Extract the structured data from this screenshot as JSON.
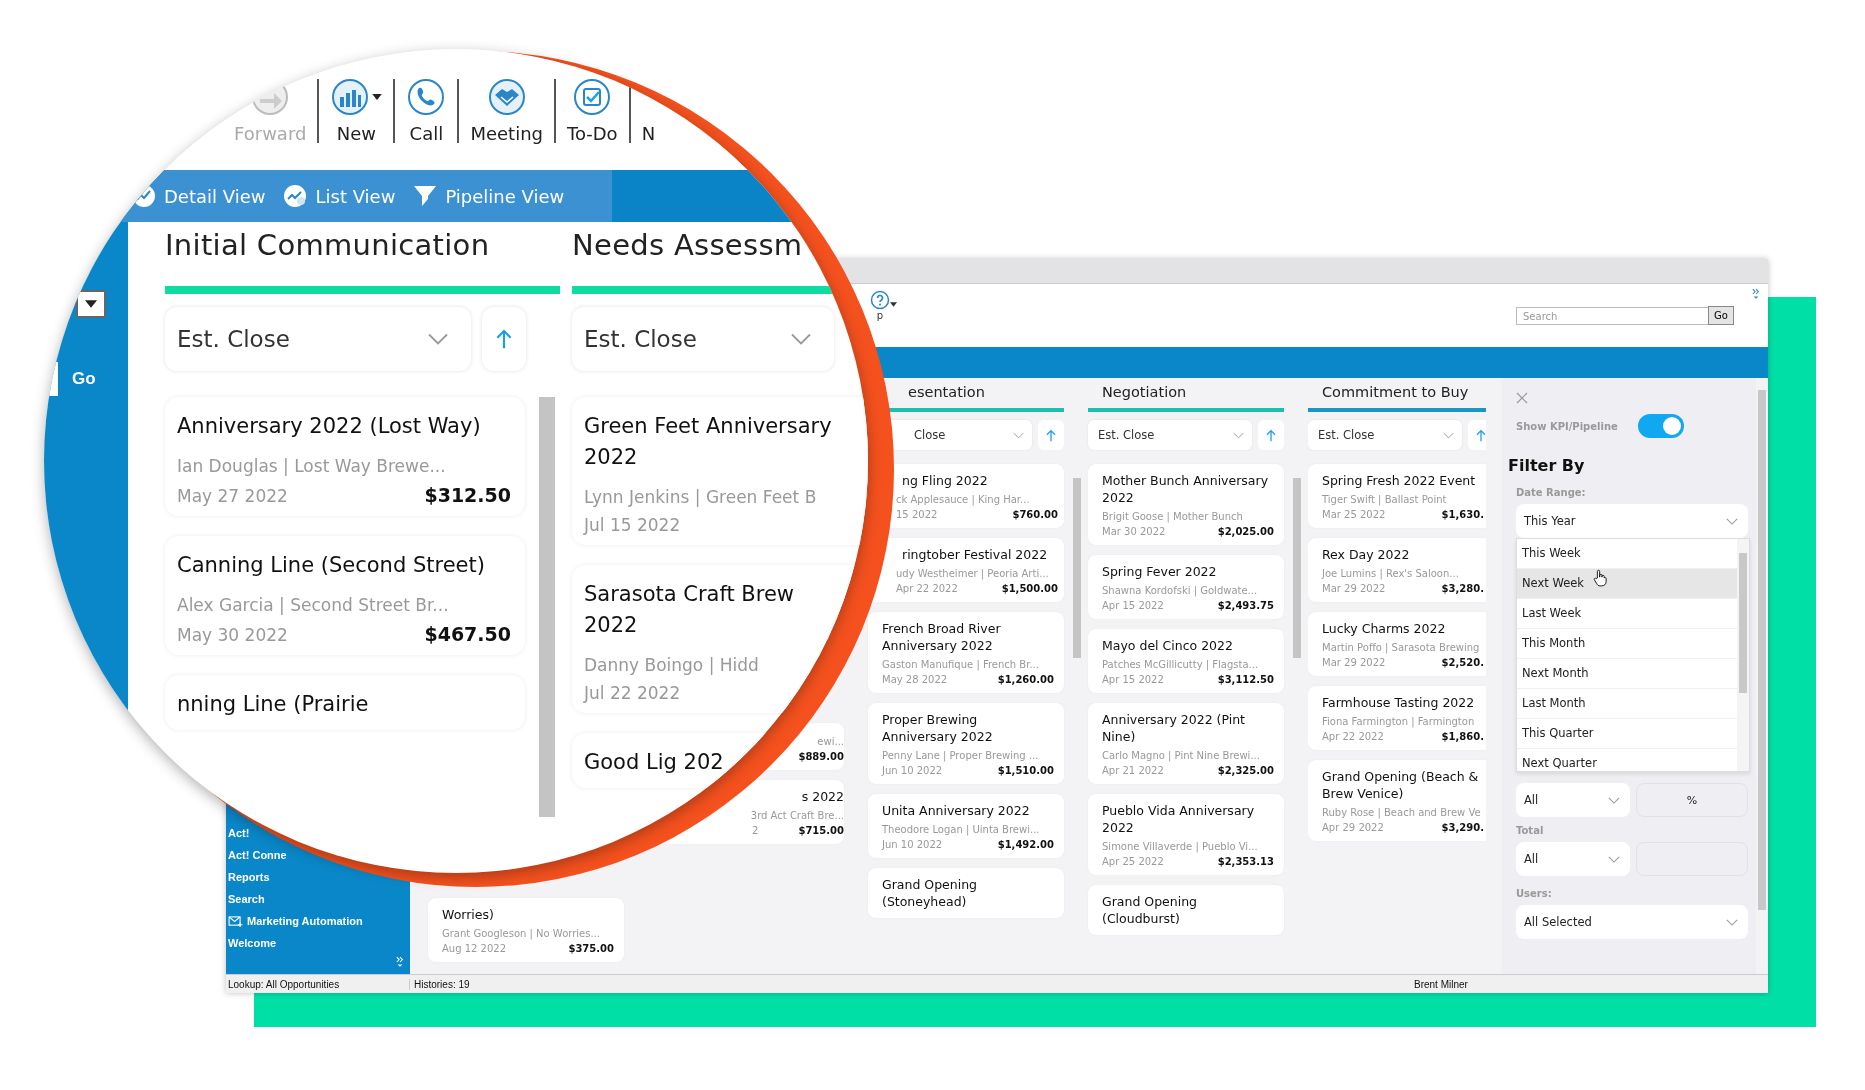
{
  "lens": {
    "toolbar": [
      {
        "kind": "forward",
        "label": "Forward",
        "disabled": true,
        "has_menu": false
      },
      {
        "kind": "new",
        "label": "New",
        "disabled": false,
        "has_menu": true
      },
      {
        "kind": "call",
        "label": "Call",
        "disabled": false,
        "has_menu": false
      },
      {
        "kind": "meeting",
        "label": "Meeting",
        "disabled": false,
        "has_menu": false
      },
      {
        "kind": "todo",
        "label": "To-Do",
        "disabled": false,
        "has_menu": false
      },
      {
        "kind": "cut",
        "label": "N",
        "disabled": false,
        "has_menu": false
      }
    ],
    "tabs": [
      {
        "kind": "detail",
        "label": "Detail View"
      },
      {
        "kind": "list",
        "label": "List View"
      },
      {
        "kind": "pipeline",
        "label": "Pipeline View"
      }
    ],
    "go_button": "Go",
    "columns": [
      {
        "title": "Initial Communication",
        "color": "#10dca2",
        "sort": "Est. Close",
        "cards": [
          {
            "title": "Anniversary 2022 (Lost Way)",
            "contact": "Ian Douglas | Lost Way Brewe...",
            "date": "May 27 2022",
            "amount": "$312.50"
          },
          {
            "title": "Canning Line (Second Street)",
            "contact": "Alex Garcia | Second Street Br...",
            "date": "May 30 2022",
            "amount": "$467.50"
          },
          {
            "title": "nning Line (Prairie"
          }
        ]
      },
      {
        "title": "Needs Assessm",
        "color": "#10dca2",
        "sort": "Est. Close",
        "cards": [
          {
            "title": "Green Feet Anniversary 2022",
            "contact": "Lynn Jenkins | Green Feet B",
            "date": "Jul 15 2022"
          },
          {
            "title": "Sarasota Craft Brew 2022",
            "contact": "Danny Boingo | Hidd",
            "date": "Jul 22 2022"
          },
          {
            "title": "Good Lig 202"
          }
        ]
      }
    ]
  },
  "window": {
    "help_text": "p",
    "search": {
      "placeholder": "Search",
      "button": "Go"
    },
    "sidebar": [
      {
        "kind": "link",
        "label": "Act!"
      },
      {
        "kind": "link",
        "label": "Act! Conne"
      },
      {
        "kind": "link",
        "label": "Reports"
      },
      {
        "kind": "link",
        "label": "Search"
      },
      {
        "kind": "mail",
        "label": "Marketing Automation"
      },
      {
        "kind": "link",
        "label": "Welcome"
      }
    ],
    "columns": [
      {
        "cards": [
          {
            "title": "Worries)",
            "contact": "Grant Googleson | No Worries...",
            "date": "Aug 12 2022",
            "amount": "$375.00"
          }
        ]
      },
      {
        "cards": [
          {
            "contact": "ewi...",
            "amount": "$889.00"
          },
          {
            "title": "s 2022",
            "contact": "3rd Act Craft Bre...",
            "date": "2",
            "amount": "$715.00"
          }
        ]
      },
      {
        "title": "esentation",
        "color": "#1dbfae",
        "sort": "Close",
        "cards": [
          {
            "title": "ng Fling 2022",
            "contact": "ck Applesauce | King Har...",
            "date": "15 2022",
            "amount": "$760.00"
          },
          {
            "title": "ringtober Festival 2022",
            "contact": "udy Westheimer | Peoria Arti...",
            "date": "Apr 22 2022",
            "amount": "$1,500.00"
          },
          {
            "title": "French Broad River Anniversary 2022",
            "contact": "Gaston Manufique | French Br...",
            "date": "May 28 2022",
            "amount": "$1,260.00"
          },
          {
            "title": "Proper Brewing Anniversary 2022",
            "contact": "Penny Lane | Proper Brewing ...",
            "date": "Jun 10 2022",
            "amount": "$1,510.00"
          },
          {
            "title": "Unita Anniversary 2022",
            "contact": "Theodore Logan | Uinta Brewi...",
            "date": "Jun 10 2022",
            "amount": "$1,492.00"
          },
          {
            "title": "Grand Opening (Stoneyhead)"
          }
        ]
      },
      {
        "title": "Negotiation",
        "color": "#1dbfae",
        "sort": "Est. Close",
        "cards": [
          {
            "title": "Mother Bunch Anniversary 2022",
            "contact": "Brigit Goose | Mother Bunch",
            "date": "Mar 30 2022",
            "amount": "$2,025.00"
          },
          {
            "title": "Spring Fever 2022",
            "contact": "Shawna Kordofski | Goldwate...",
            "date": "Apr 15 2022",
            "amount": "$2,493.75"
          },
          {
            "title": "Mayo del Cinco 2022",
            "contact": "Patches McGillicutty | Flagsta...",
            "date": "Apr 15 2022",
            "amount": "$3,112.50"
          },
          {
            "title": "Anniversary 2022 (Pint Nine)",
            "contact": "Carlo Magno | Pint Nine Brewi...",
            "date": "Apr 21 2022",
            "amount": "$2,325.00"
          },
          {
            "title": "Pueblo Vida Anniversary 2022",
            "contact": "Simone Villaverde | Pueblo Vi...",
            "date": "Apr 25 2022",
            "amount": "$2,353.13"
          },
          {
            "title": "Grand Opening (Cloudburst)"
          }
        ]
      },
      {
        "title": "Commitment to Buy",
        "color": "#1a95c8",
        "sort": "Est. Close",
        "cards": [
          {
            "title": "Spring Fresh 2022 Event",
            "contact": "Tiger Swift | Ballast Point",
            "date": "Mar 25 2022",
            "amount": "$1,630."
          },
          {
            "title": "Rex Day 2022",
            "contact": "Joe Lumins | Rex's Saloon...",
            "date": "Mar 29 2022",
            "amount": "$3,280."
          },
          {
            "title": "Lucky Charms 2022",
            "contact": "Martin Poffo | Sarasota Brewing",
            "date": "Mar 29 2022",
            "amount": "$2,520."
          },
          {
            "title": "Farmhouse Tasting 2022",
            "contact": "Fiona Farmington | Farmington",
            "date": "Apr 22 2022",
            "amount": "$1,860."
          },
          {
            "title": "Grand Opening (Beach & Brew Venice)",
            "contact": "Ruby Rose | Beach and Brew Ve",
            "date": "Apr 29 2022",
            "amount": "$3,290."
          }
        ]
      }
    ],
    "filter": {
      "toggle": {
        "label": "Show KPI/Pipeline",
        "on": true
      },
      "heading": "Filter By",
      "date_range": {
        "label": "Date Range:",
        "value": "This Year",
        "expanded": true,
        "options": [
          {
            "label": "This Week",
            "selected": false
          },
          {
            "label": "Next Week",
            "selected": true
          },
          {
            "label": "Last Week",
            "selected": false
          },
          {
            "label": "This Month",
            "selected": false
          },
          {
            "label": "Next Month",
            "selected": false
          },
          {
            "label": "Last Month",
            "selected": false
          },
          {
            "label": "This Quarter",
            "selected": false
          },
          {
            "label": "Next Quarter",
            "selected": false
          }
        ]
      },
      "probability": {
        "value": "All",
        "unit": "%"
      },
      "total": {
        "label": "Total",
        "value": "All"
      },
      "users": {
        "label": "Users:",
        "value": "All Selected"
      }
    },
    "status_bar": [
      "Lookup: All Opportunities",
      "Histories: 19",
      "Brent Milner"
    ]
  }
}
